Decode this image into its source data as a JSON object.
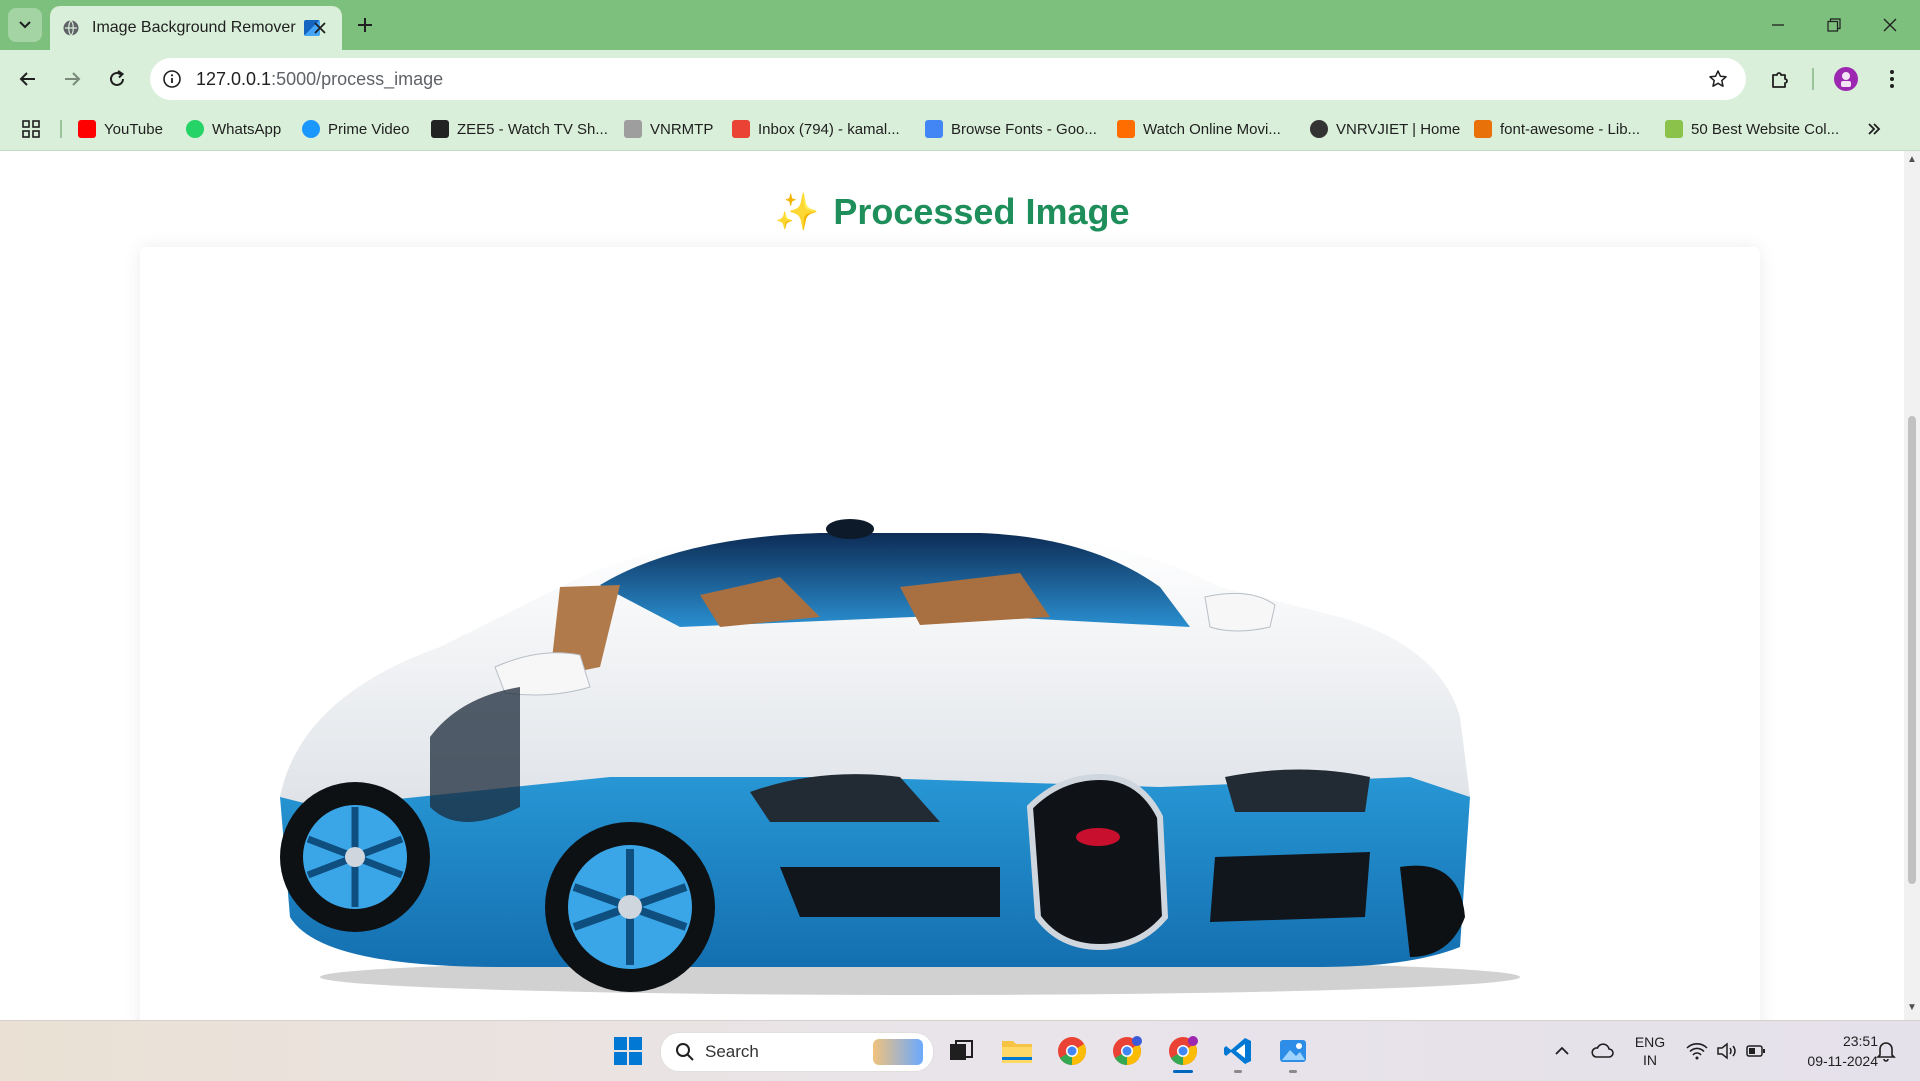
{
  "browser": {
    "tab": {
      "title": "Image Background Remover"
    },
    "address_bar": {
      "url_host": "127.0.0.1",
      "url_rest": ":5000/process_image"
    },
    "bookmarks": [
      {
        "label": "YouTube",
        "icon": "youtube-icon",
        "color": "#ff0000"
      },
      {
        "label": "WhatsApp",
        "icon": "whatsapp-icon",
        "color": "#25d366"
      },
      {
        "label": "Prime Video",
        "icon": "prime-video-icon",
        "color": "#1a98ff"
      },
      {
        "label": "ZEE5 - Watch TV Sh...",
        "icon": "zee5-icon",
        "color": "#222222"
      },
      {
        "label": "VNRMTP",
        "icon": "vnrmtp-icon",
        "color": "#9e9e9e"
      },
      {
        "label": "Inbox (794) - kamal...",
        "icon": "gmail-icon",
        "color": "#ea4335"
      },
      {
        "label": "Browse Fonts - Goo...",
        "icon": "google-fonts-icon",
        "color": "#4285f4"
      },
      {
        "label": "Watch Online Movi...",
        "icon": "aha-icon",
        "color": "#ff6d00"
      },
      {
        "label": "VNRVJIET | Home",
        "icon": "vnrvjiet-icon",
        "color": "#333333"
      },
      {
        "label": "font-awesome - Lib...",
        "icon": "code-icon",
        "color": "#e8710a"
      },
      {
        "label": "50 Best Website Col...",
        "icon": "website-colors-icon",
        "color": "#8bc34a"
      }
    ]
  },
  "page": {
    "heading": "Processed Image",
    "heading_emoji": "✨"
  },
  "taskbar": {
    "search_label": "Search",
    "language_line1": "ENG",
    "language_line2": "IN",
    "time": "23:51",
    "date": "09-11-2024"
  }
}
